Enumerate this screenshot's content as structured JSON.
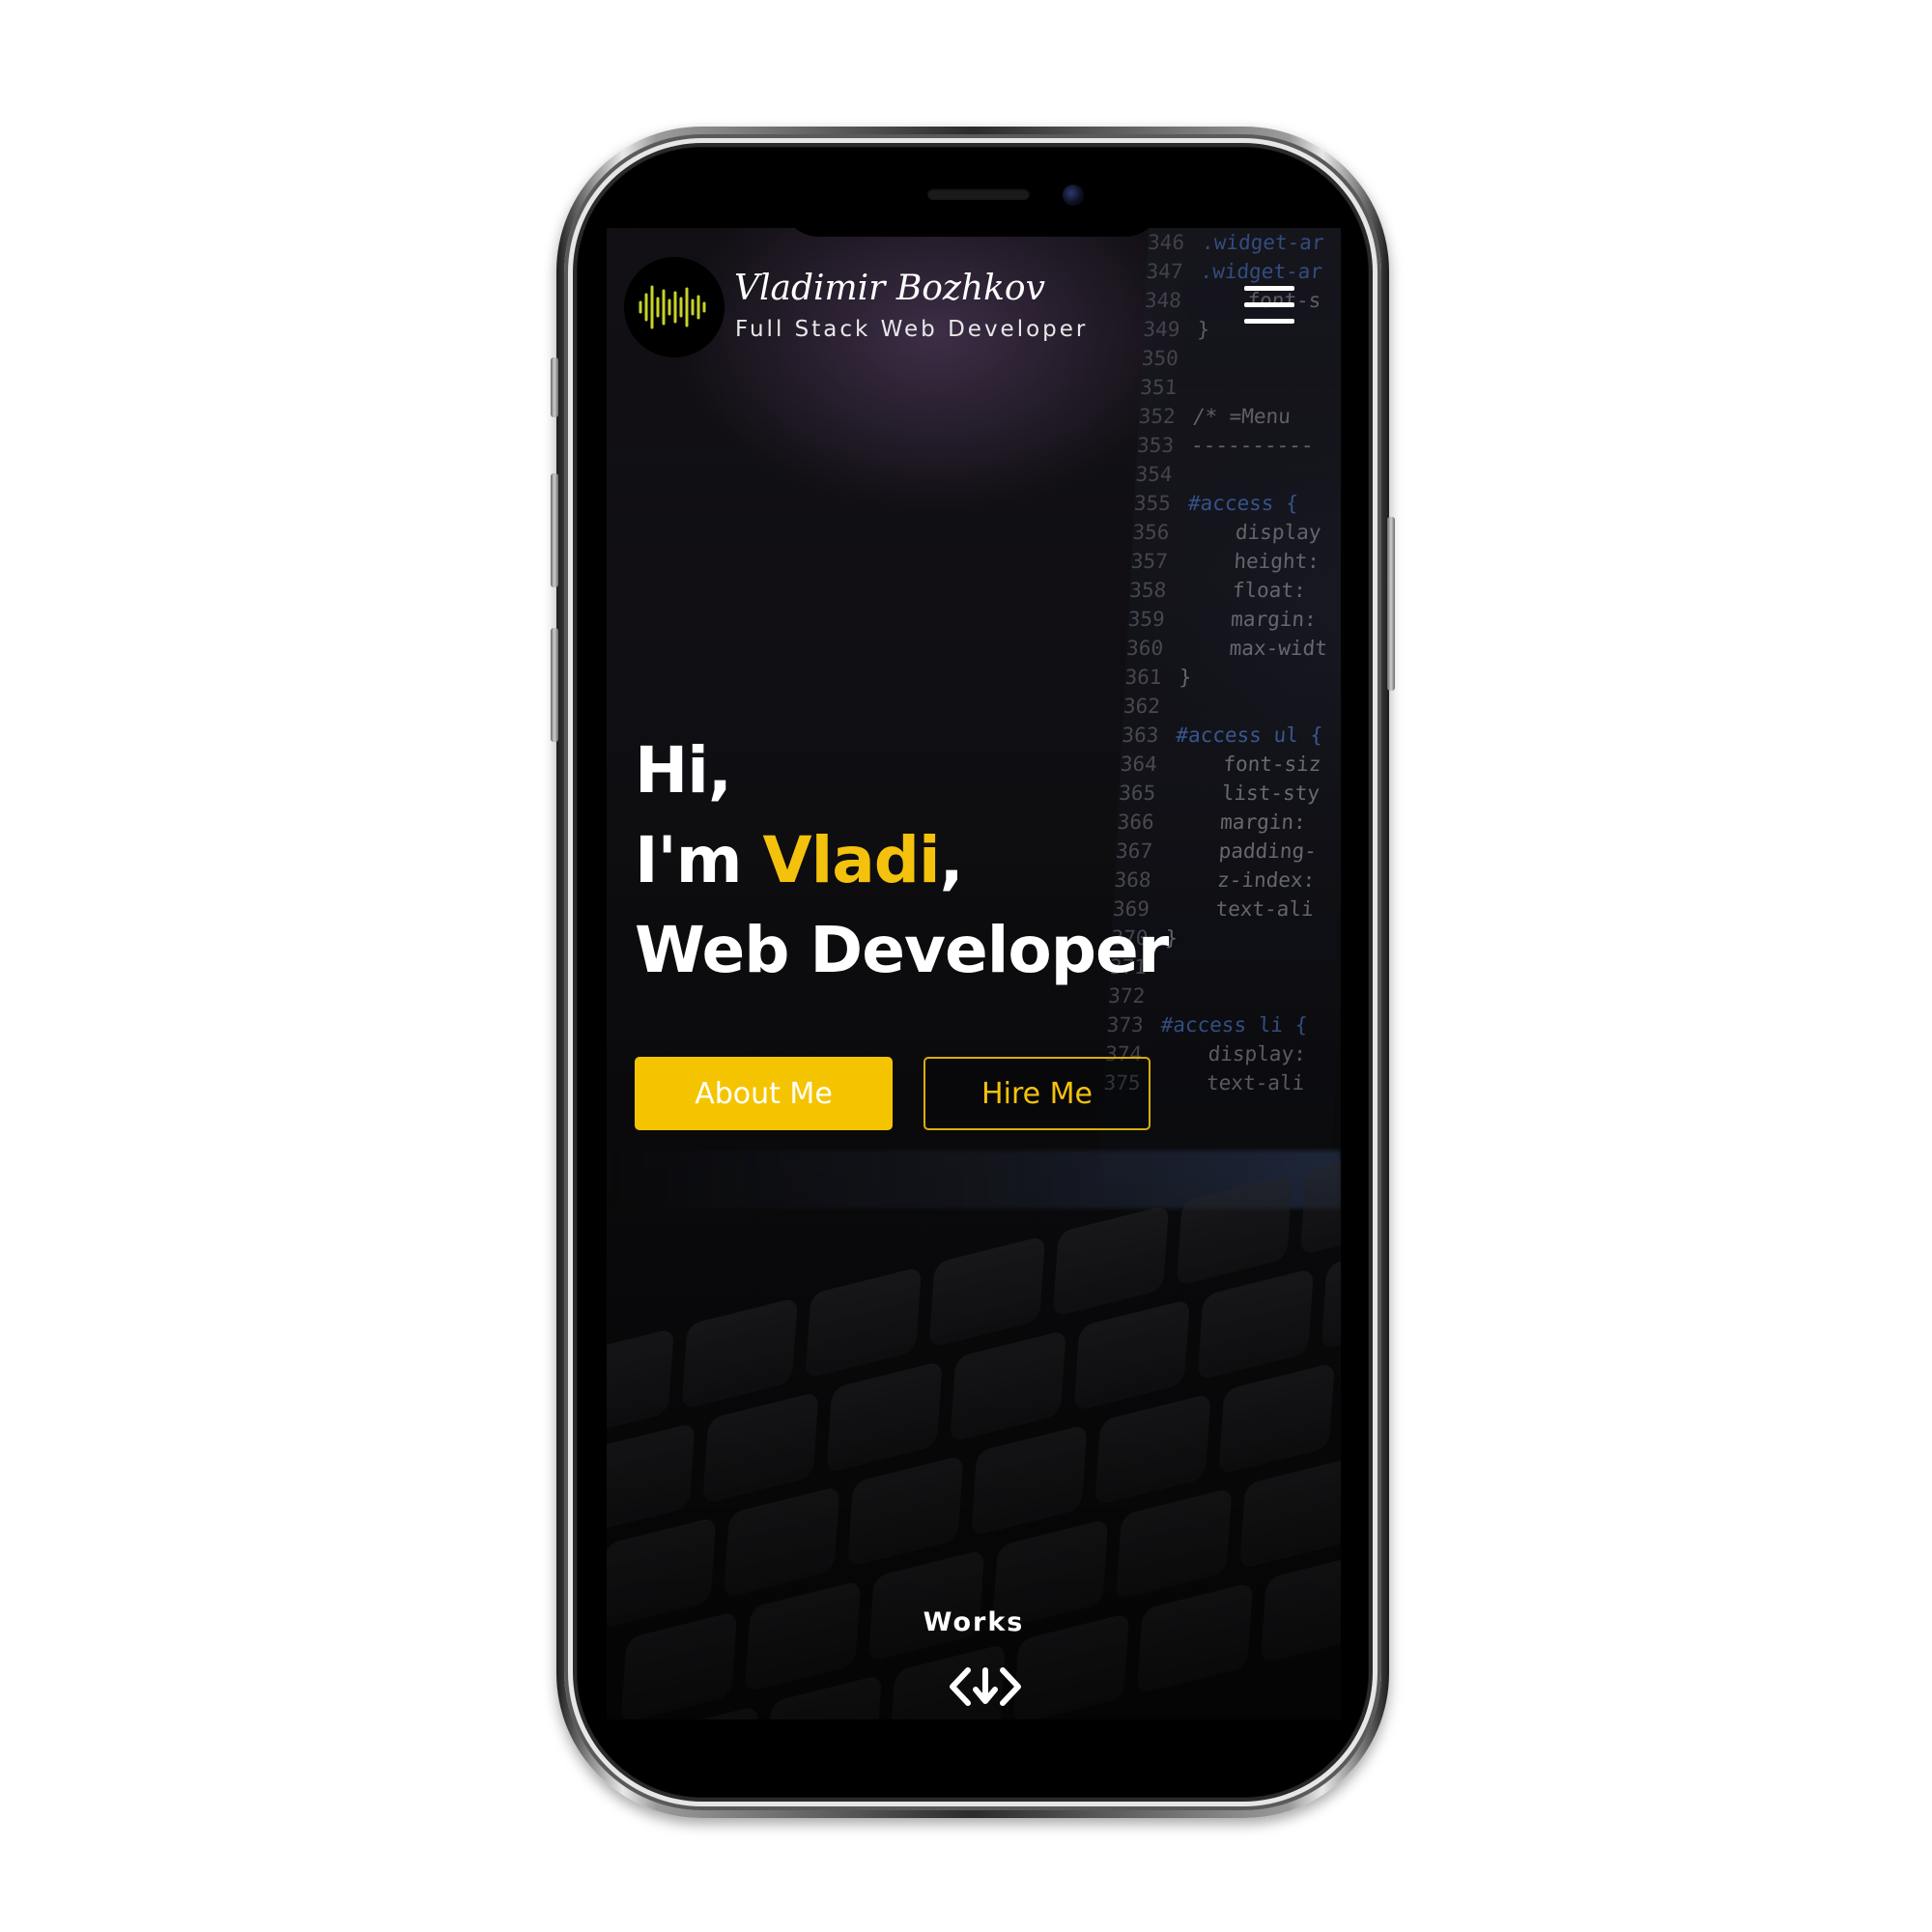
{
  "header": {
    "brand_name": "Vladimir Bozhkov",
    "brand_subtitle": "Full Stack Web Developer",
    "logo_icon": "sound-wave-icon",
    "menu_icon": "hamburger-menu-icon"
  },
  "hero": {
    "line1": "Hi,",
    "line2_prefix": "I'm ",
    "line2_accent": "Vladi",
    "line2_suffix": ",",
    "line3": "Web Developer"
  },
  "buttons": {
    "about_label": "About Me",
    "hire_label": "Hire Me"
  },
  "works": {
    "label": "Works",
    "icon": "code-down-arrow-icon"
  },
  "background_code": [
    {
      "ln": "346",
      "code": ".widget-ar"
    },
    {
      "ln": "347",
      "code": ".widget-ar"
    },
    {
      "ln": "348",
      "code": "    font-s"
    },
    {
      "ln": "349",
      "code": "}"
    },
    {
      "ln": "350",
      "code": ""
    },
    {
      "ln": "351",
      "code": ""
    },
    {
      "ln": "352",
      "code": "/* =Menu"
    },
    {
      "ln": "353",
      "code": "----------"
    },
    {
      "ln": "354",
      "code": ""
    },
    {
      "ln": "355",
      "code": "#access {"
    },
    {
      "ln": "356",
      "code": "    display"
    },
    {
      "ln": "357",
      "code": "    height:"
    },
    {
      "ln": "358",
      "code": "    float:"
    },
    {
      "ln": "359",
      "code": "    margin:"
    },
    {
      "ln": "360",
      "code": "    max-widt"
    },
    {
      "ln": "361",
      "code": "}"
    },
    {
      "ln": "362",
      "code": ""
    },
    {
      "ln": "363",
      "code": "#access ul {"
    },
    {
      "ln": "364",
      "code": "    font-siz"
    },
    {
      "ln": "365",
      "code": "    list-sty"
    },
    {
      "ln": "366",
      "code": "    margin:"
    },
    {
      "ln": "367",
      "code": "    padding-"
    },
    {
      "ln": "368",
      "code": "    z-index:"
    },
    {
      "ln": "369",
      "code": "    text-ali"
    },
    {
      "ln": "370",
      "code": "}"
    },
    {
      "ln": "371",
      "code": ""
    },
    {
      "ln": "372",
      "code": ""
    },
    {
      "ln": "373",
      "code": "#access li {"
    },
    {
      "ln": "374",
      "code": "    display:"
    },
    {
      "ln": "375",
      "code": "    text-ali"
    }
  ],
  "colors": {
    "accent": "#f5c400",
    "text": "#ffffff",
    "background": "#0b0b0d"
  }
}
